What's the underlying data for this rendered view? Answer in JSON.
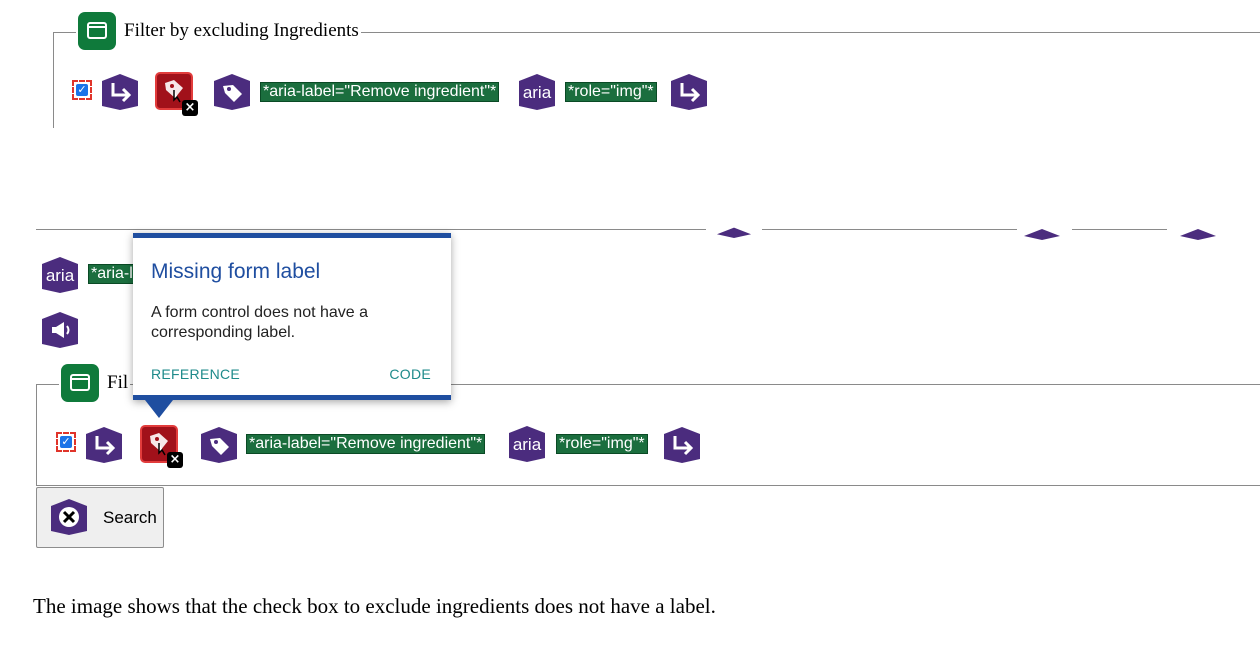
{
  "top_fieldset": {
    "legend": "Filter by excluding Ingredients",
    "aria_label_tag": "*aria-label=\"Remove ingredient\"*",
    "aria_badge": "aria",
    "role_tag": "*role=\"img\"*"
  },
  "middle": {
    "aria_badge": "aria",
    "aria_tag_partial": "*aria-l"
  },
  "tooltip": {
    "title": "Missing form label",
    "body": "A form control does not have a corresponding label.",
    "reference": "REFERENCE",
    "code": "CODE"
  },
  "bottom_fieldset": {
    "legend_partial": "Fil",
    "aria_label_tag": "*aria-label=\"Remove ingredient\"*",
    "aria_badge": "aria",
    "role_tag": "*role=\"img\"*"
  },
  "search_button": {
    "label": "Search"
  },
  "caption": "The image shows that the check box to exclude ingredients does not have a label.",
  "colors": {
    "purple": "#4b2c7e",
    "green": "#1b6e3e",
    "tooltip_blue": "#1f4ea0",
    "error_red": "#a1111a"
  }
}
